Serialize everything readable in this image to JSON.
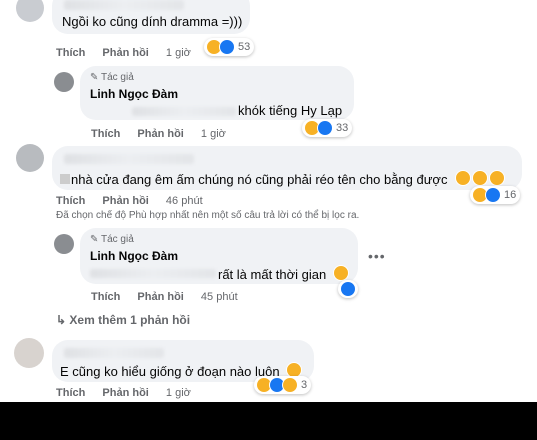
{
  "comment1": {
    "text": "Ngồi ko cũng dính dramma =)))",
    "actions": [
      "Thích",
      "Phản hồi"
    ],
    "time": "1 giờ",
    "reaction_count": "53"
  },
  "reply1": {
    "badge": "Tác giả",
    "author": "Linh Ngọc Đàm",
    "text": "khók tiếng Hy Lạp",
    "actions": [
      "Thích",
      "Phản hồi"
    ],
    "time": "1 giờ",
    "reaction_count": "33"
  },
  "comment2": {
    "text": "nhà cửa đang êm ấm chúng nó cũng phải réo tên cho bằng được",
    "actions": [
      "Thích",
      "Phản hồi"
    ],
    "time": "46 phút",
    "reaction_count": "16"
  },
  "filter_notice": "Đã chọn chế độ Phù hợp nhất nên một số câu trả lời có thể bị lọc ra.",
  "reply2": {
    "badge": "Tác giả",
    "author": "Linh Ngọc Đàm",
    "text": "rất là mất thời gian",
    "actions": [
      "Thích",
      "Phản hồi"
    ],
    "time": "45 phút"
  },
  "view_more": "Xem thêm 1 phản hồi",
  "comment3": {
    "text": "E cũng ko hiểu giống ở đoạn nào luôn",
    "actions": [
      "Thích",
      "Phản hồi"
    ],
    "time": "1 giờ",
    "reaction_count": "3"
  },
  "colors": {
    "bubble": "#f0f2f5",
    "meta": "#65676b",
    "like": "#1877f2",
    "haha": "#f7b125"
  }
}
